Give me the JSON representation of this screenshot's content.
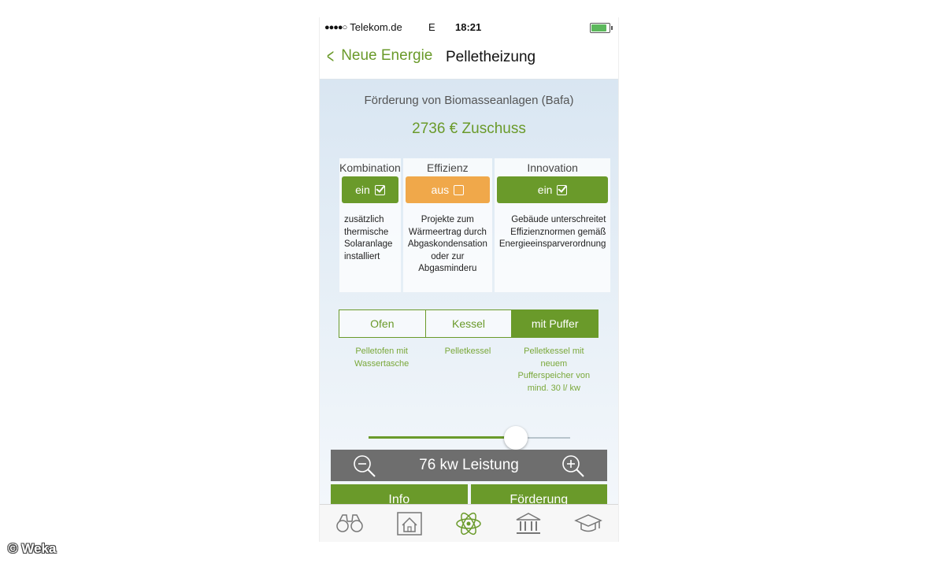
{
  "status_bar": {
    "carrier": "Telekom.de",
    "network": "E",
    "time": "18:21"
  },
  "nav": {
    "back_label": "Neue Energie",
    "title": "Pelletheizung"
  },
  "subsidy": {
    "title": "Förderung von Biomasseanlagen (Bafa)",
    "amount": "2736 € Zuschuss"
  },
  "options": [
    {
      "name": "Kombination",
      "state": "ein",
      "checked": true,
      "description": "zusätzlich thermische Solaranlage installiert"
    },
    {
      "name": "Effizienz",
      "state": "aus",
      "checked": false,
      "description": "Projekte zum Wärmeertrag durch Abgaskondensation oder zur Abgasminderu"
    },
    {
      "name": "Innovation",
      "state": "ein",
      "checked": true,
      "description": "Gebäude unterschreitet Effizienznormen gemäß Energieeinsparverordnung"
    }
  ],
  "segments": [
    {
      "label": "Ofen",
      "description": "Pelletofen mit Wassertasche",
      "active": false
    },
    {
      "label": "Kessel",
      "description": "Pelletkessel",
      "active": false
    },
    {
      "label": "mit Puffer",
      "description": "Pelletkessel mit neuem Pufferspeicher von mind. 30 l/ kw",
      "active": true
    }
  ],
  "slider": {
    "value": 0.73
  },
  "power": {
    "label": "76 kw Leistung"
  },
  "actions": {
    "info": "Info",
    "foerderung": "Förderung"
  },
  "tabs": [
    "binoculars-icon",
    "house-icon",
    "atom-icon",
    "bank-icon",
    "graduation-cap-icon"
  ],
  "colors": {
    "accent": "#6a9a2a",
    "off": "#f0a84a",
    "power_bar": "#6e6e6e"
  },
  "watermark": "© Weka"
}
